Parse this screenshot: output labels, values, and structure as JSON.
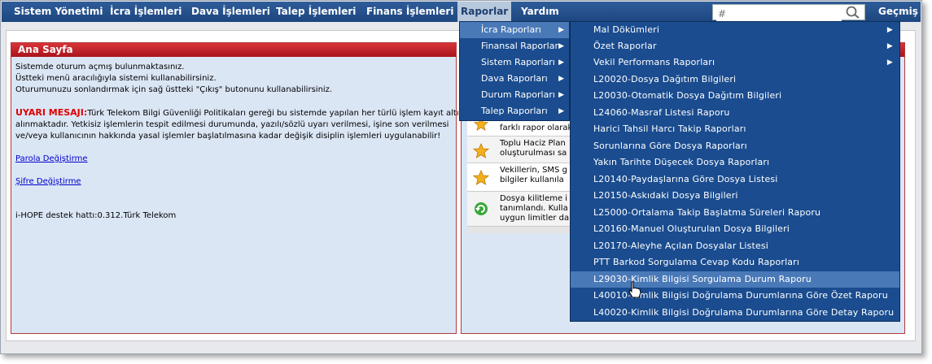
{
  "nav": {
    "items": [
      "Sistem Yönetimi",
      "İcra İşlemleri",
      "Dava İşlemleri",
      "Talep İşlemleri",
      "Finans İşlemleri",
      "Raporlar",
      "Yardım"
    ],
    "search_placeholder": "#",
    "history_label": "Geçmiş"
  },
  "home_panel": {
    "title": "Ana Sayfa",
    "lines": [
      "Sistemde oturum açmış bulunmaktasınız.",
      "Üstteki menü aracılığıyla sistemi kullanabilirsiniz.",
      "Oturumunuzu sonlandırmak için sağ üstteki \"Çıkış\" butonunu kullanabilirsiniz."
    ],
    "warning_label": "UYARI MESAJI:",
    "warning_lines": [
      "Türk Telekom Bilgi Güvenliği Politikaları gereği bu sistemde yapılan her türlü işlem kayıt altına",
      "alınmaktadır. Yetkisiz işlemlerin tespit edilmesi durumunda, yazılı/sözlü uyarı verilmesi, işine son verilmesi",
      "ve/veya kullanıcının hakkında yasal işlemler başlatılmasına kadar değişik disiplin işlemleri uygulanabilir!"
    ],
    "link_password": "Parola Değiştirme",
    "link_sifre": "Şifre Değiştirme",
    "support_line": "i-HOPE destek hattı:0.312.Türk Telekom"
  },
  "news_items": [
    {
      "icon": "star-icon",
      "lines": [
        "farklı rapor olarak"
      ]
    },
    {
      "icon": "star-icon",
      "lines": [
        "Toplu Haciz Plan",
        "oluşturulması sa"
      ]
    },
    {
      "icon": "star-icon",
      "lines": [
        "Vekillerin, SMS g",
        "bilgiler kullanıla"
      ]
    },
    {
      "icon": "refresh-icon",
      "lines": [
        "Dosya kilitleme i",
        "tanımlandı. Kulla",
        "uygun limitler da"
      ]
    }
  ],
  "raporlar_menu": {
    "items": [
      {
        "label": "İcra Raporları",
        "submenu": true,
        "highlighted": true
      },
      {
        "label": "Finansal Raporlar",
        "submenu": true
      },
      {
        "label": "Sistem Raporları",
        "submenu": true
      },
      {
        "label": "Dava Raporları",
        "submenu": true
      },
      {
        "label": "Durum Raporları",
        "submenu": true
      },
      {
        "label": "Talep Raporları",
        "submenu": true
      }
    ]
  },
  "icra_submenu": {
    "items": [
      {
        "label": "Mal Dökümleri",
        "submenu": true
      },
      {
        "label": "Özet Raporlar",
        "submenu": true
      },
      {
        "label": "Vekil Performans Raporları",
        "submenu": true
      },
      {
        "label": "L20020-Dosya Dağıtım Bilgileri"
      },
      {
        "label": "L20030-Otomatik Dosya Dağıtım Bilgileri"
      },
      {
        "label": "L24060-Masraf Listesi Raporu"
      },
      {
        "label": "Harici Tahsil Harcı Takip Raporları"
      },
      {
        "label": "Sorunlarına Göre Dosya Raporları"
      },
      {
        "label": "Yakın Tarihte Düşecek Dosya Raporları"
      },
      {
        "label": "L20140-Paydaşlarına Göre Dosya Listesi"
      },
      {
        "label": "L20150-Askıdaki Dosya Bilgileri"
      },
      {
        "label": "L25000-Ortalama Takip Başlatma Süreleri Raporu"
      },
      {
        "label": "L20160-Manuel Oluşturulan Dosya Bilgileri"
      },
      {
        "label": "L20170-Aleyhe Açılan Dosyalar Listesi"
      },
      {
        "label": "PTT Barkod Sorgulama Cevap Kodu Raporları"
      },
      {
        "label": "L29030-Kimlik Bilgisi Sorgulama Durum Raporu",
        "highlighted": true
      },
      {
        "label": "L40010-Kimlik Bilgisi Doğrulama Durumlarına Göre Özet Raporu"
      },
      {
        "label": "L40020-Kimlik Bilgisi Doğrulama Durumlarına Göre Detay Raporu"
      }
    ]
  },
  "colors": {
    "nav_bg": "#1d467e",
    "panel_title": "#c0242a",
    "menu_bg": "#1a4c8f",
    "menu_highlight": "#4a79b8",
    "warning": "#e00000"
  }
}
